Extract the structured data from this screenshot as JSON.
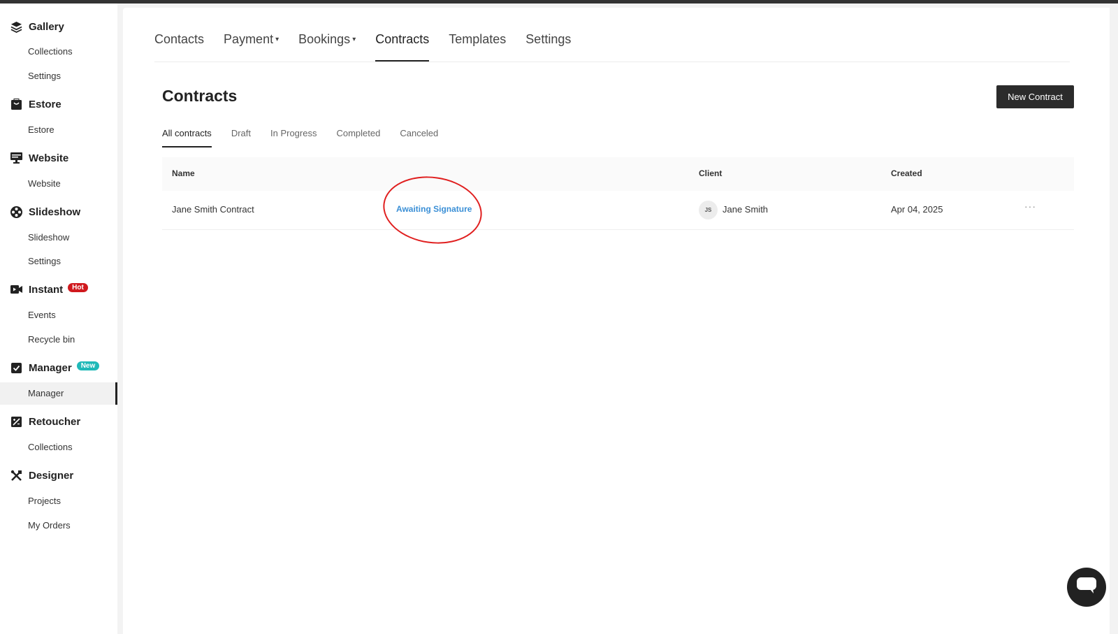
{
  "sidebar": {
    "sections": [
      {
        "title": "Gallery",
        "icon": "layers-icon",
        "items": [
          "Collections",
          "Settings"
        ]
      },
      {
        "title": "Estore",
        "icon": "store-icon",
        "items": [
          "Estore"
        ]
      },
      {
        "title": "Website",
        "icon": "monitor-icon",
        "items": [
          "Website"
        ]
      },
      {
        "title": "Slideshow",
        "icon": "film-reel-icon",
        "items": [
          "Slideshow",
          "Settings"
        ]
      },
      {
        "title": "Instant",
        "icon": "video-camera-icon",
        "badge": "Hot",
        "items": [
          "Events",
          "Recycle bin"
        ]
      },
      {
        "title": "Manager",
        "icon": "checkbox-icon",
        "badge": "New",
        "items": [
          "Manager"
        ]
      },
      {
        "title": "Retoucher",
        "icon": "retouch-icon",
        "items": [
          "Collections"
        ]
      },
      {
        "title": "Designer",
        "icon": "design-tools-icon",
        "items": [
          "Projects",
          "My Orders"
        ]
      }
    ],
    "active_item": "Manager"
  },
  "topnav": {
    "items": [
      "Contacts",
      "Payment",
      "Bookings",
      "Contracts",
      "Templates",
      "Settings"
    ],
    "active": "Contracts"
  },
  "page": {
    "title": "Contracts",
    "new_button": "New Contract",
    "subtabs": [
      "All contracts",
      "Draft",
      "In Progress",
      "Completed",
      "Canceled"
    ],
    "active_subtab": "All contracts"
  },
  "table": {
    "headers": {
      "name": "Name",
      "client": "Client",
      "created": "Created"
    },
    "rows": [
      {
        "name": "Jane Smith Contract",
        "status": "Awaiting Signature",
        "client_initials": "JS",
        "client": "Jane Smith",
        "created": "Apr 04, 2025",
        "more": "···"
      }
    ]
  },
  "colors": {
    "status_blue": "#3a8fd6",
    "annotation_red": "#e01f1f",
    "hot_badge": "#d0191e",
    "new_badge": "#1fb9b8",
    "dark_button": "#2b2b2b"
  }
}
